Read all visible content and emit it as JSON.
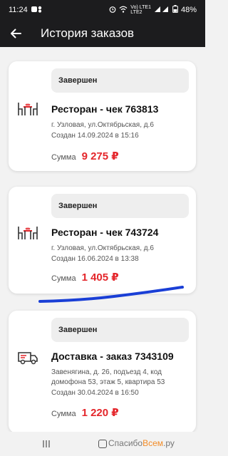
{
  "status": {
    "time": "11:24",
    "network_top": "Vo) LTE1",
    "network_bottom": "LTE2",
    "battery": "48%"
  },
  "app_bar": {
    "title": "История заказов"
  },
  "orders": [
    {
      "status": "Завершен",
      "icon": "restaurant-icon",
      "title": "Ресторан - чек 763813",
      "address": "г. Узловая, ул.Октябрьская, д.6",
      "created": "Создан 14.09.2024 в 15:16",
      "sum_label": "Сумма",
      "sum": "9 275 ₽"
    },
    {
      "status": "Завершен",
      "icon": "restaurant-icon",
      "title": "Ресторан - чек 743724",
      "address": "г. Узловая, ул.Октябрьская, д.6",
      "created": "Создан 16.06.2024 в 13:38",
      "sum_label": "Сумма",
      "sum": "1 405 ₽"
    },
    {
      "status": "Завершен",
      "icon": "delivery-truck-icon",
      "title": "Доставка - заказ 7343109",
      "address_line1": "Завенягина, д. 26, подъезд 4, код",
      "address_line2": "домофона 53, этаж 5, квартира 53",
      "created": "Создан 30.04.2024 в 16:50",
      "sum_label": "Сумма",
      "sum": "1 220 ₽"
    }
  ],
  "watermark": {
    "left": "Спасибо",
    "accent": "Всем",
    "right": ".ру"
  },
  "colors": {
    "accent_red": "#e4262b",
    "bar_dark": "#1c1c1e",
    "annotation_blue": "#1a3fd6"
  }
}
